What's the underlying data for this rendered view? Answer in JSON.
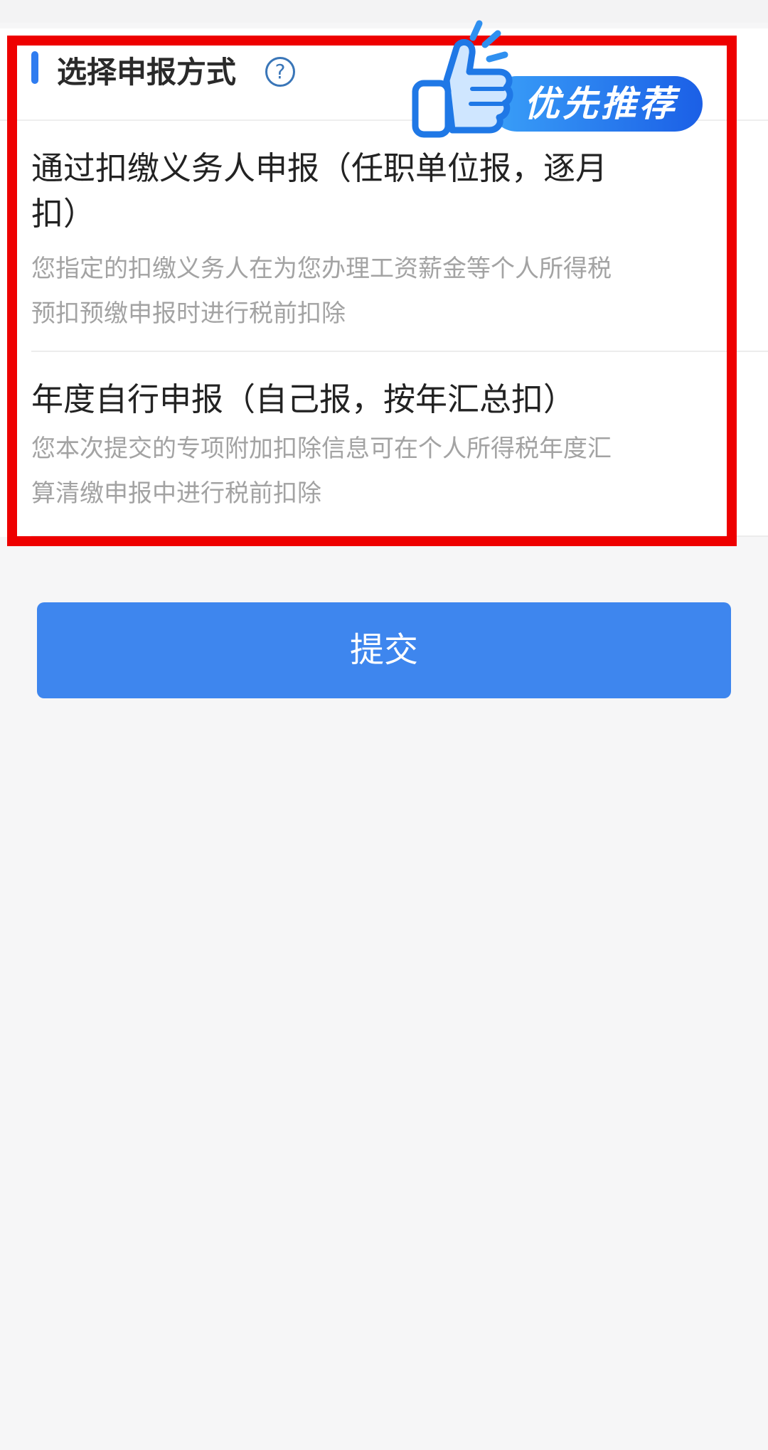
{
  "section": {
    "title": "选择申报方式",
    "help_symbol": "?"
  },
  "badge": {
    "text": "优先推荐"
  },
  "options": [
    {
      "title": "通过扣缴义务人申报（任职单位报，逐月扣）",
      "description": "您指定的扣缴义务人在为您办理工资薪金等个人所得税预扣预缴申报时进行税前扣除"
    },
    {
      "title": "年度自行申报（自己报，按年汇总扣）",
      "description": "您本次提交的专项附加扣除信息可在个人所得税年度汇算清缴申报中进行税前扣除"
    }
  ],
  "submit": {
    "label": "提交"
  },
  "colors": {
    "accent": "#2f7cf0",
    "button": "#3e86ee",
    "highlight": "#ee0000"
  },
  "icons": {
    "help": "question-circle-icon",
    "recommend": "thumbs-up-icon"
  }
}
